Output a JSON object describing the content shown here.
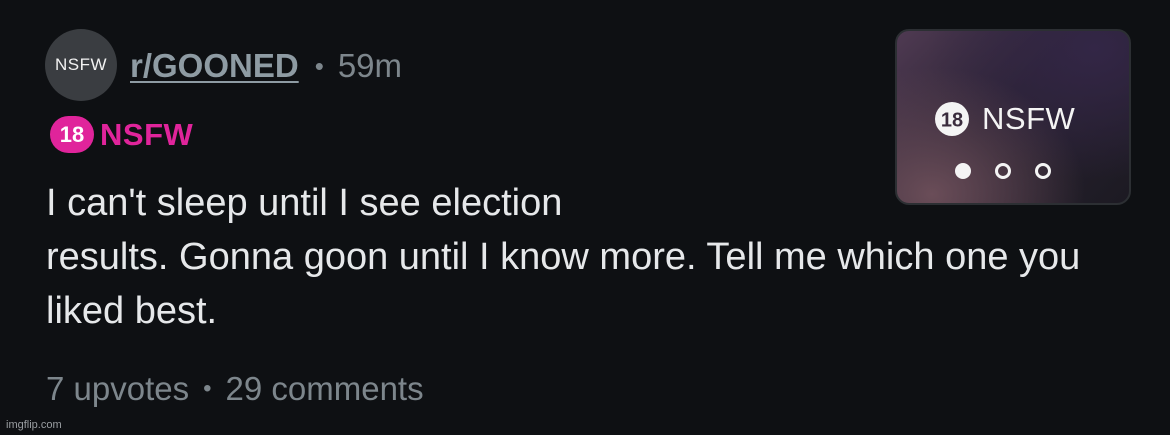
{
  "post": {
    "avatar_text": "NSFW",
    "subreddit": "r/GOONED",
    "separator": "•",
    "age": "59m",
    "nsfw_tag": {
      "badge": "18",
      "label": "NSFW",
      "color": "#e0249b"
    },
    "title_line1": "I can't sleep until I see election",
    "title_rest": "results. Gonna goon until I know more. Tell me which one you liked best.",
    "thumbnail": {
      "badge": "18",
      "label": "NSFW",
      "pages": 3,
      "active_page": 1
    },
    "upvotes": "7 upvotes",
    "comments": "29 comments"
  },
  "watermark": "imgflip.com",
  "colors": {
    "background": "#0e1013",
    "text": "#e6e8ea",
    "muted": "#7d868c",
    "subreddit": "#8e9ba3"
  }
}
